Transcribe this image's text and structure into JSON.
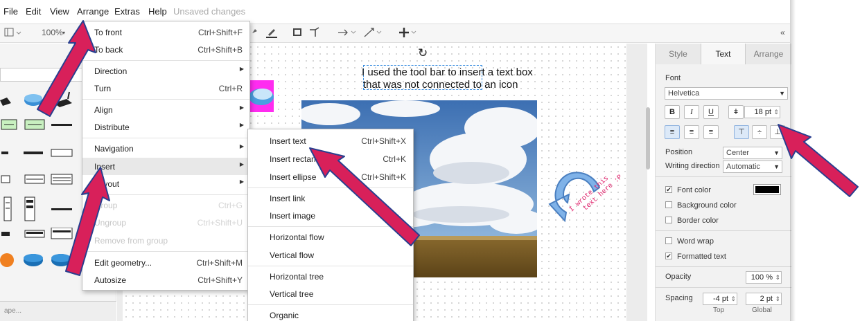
{
  "menubar": {
    "items": [
      "File",
      "Edit",
      "View",
      "Arrange",
      "Extras",
      "Help"
    ],
    "status": "Unsaved changes"
  },
  "toolbar": {
    "zoom": "100%"
  },
  "left_panel": {
    "footer_text": "ape..."
  },
  "canvas": {
    "textbox_line1": "I used the tool bar to insert a text box",
    "textbox_line2": "that was not connected to an icon",
    "handwritten_line1": "I wrote this",
    "handwritten_line2": "text here :P"
  },
  "arrange_menu": {
    "items": [
      {
        "label": "To front",
        "shortcut": "Ctrl+Shift+F"
      },
      {
        "label": "To back",
        "shortcut": "Ctrl+Shift+B"
      },
      {
        "label": "Direction",
        "shortcut": ""
      },
      {
        "label": "Turn",
        "shortcut": "Ctrl+R"
      },
      {
        "label": "Align",
        "shortcut": ""
      },
      {
        "label": "Distribute",
        "shortcut": ""
      },
      {
        "label": "Navigation",
        "shortcut": ""
      },
      {
        "label": "Insert",
        "shortcut": ""
      },
      {
        "label": "Layout",
        "shortcut": ""
      },
      {
        "label": "Group",
        "shortcut": "Ctrl+G"
      },
      {
        "label": "Ungroup",
        "shortcut": "Ctrl+Shift+U"
      },
      {
        "label": "Remove from group",
        "shortcut": ""
      },
      {
        "label": "Edit geometry...",
        "shortcut": "Ctrl+Shift+M"
      },
      {
        "label": "Autosize",
        "shortcut": "Ctrl+Shift+Y"
      }
    ]
  },
  "insert_submenu": {
    "items": [
      {
        "label": "Insert text",
        "shortcut": "Ctrl+Shift+X"
      },
      {
        "label": "Insert rectangle",
        "shortcut": "Ctrl+K"
      },
      {
        "label": "Insert ellipse",
        "shortcut": "Ctrl+Shift+K"
      },
      {
        "label": "Insert link",
        "shortcut": ""
      },
      {
        "label": "Insert image",
        "shortcut": ""
      },
      {
        "label": "Horizontal flow",
        "shortcut": ""
      },
      {
        "label": "Vertical flow",
        "shortcut": ""
      },
      {
        "label": "Horizontal tree",
        "shortcut": ""
      },
      {
        "label": "Vertical tree",
        "shortcut": ""
      },
      {
        "label": "Organic",
        "shortcut": ""
      }
    ]
  },
  "format_panel": {
    "tabs": [
      "Style",
      "Text",
      "Arrange"
    ],
    "font_heading": "Font",
    "font_family": "Helvetica",
    "bold": "B",
    "italic": "I",
    "underline": "U",
    "font_size": "18 pt",
    "position_label": "Position",
    "position_value": "Center",
    "writing_direction_label": "Writing direction",
    "writing_direction_value": "Automatic",
    "font_color_label": "Font color",
    "background_color_label": "Background color",
    "border_color_label": "Border color",
    "word_wrap_label": "Word wrap",
    "formatted_text_label": "Formatted text",
    "opacity_label": "Opacity",
    "opacity_value": "100 %",
    "spacing_label": "Spacing",
    "spacing_top_value": "-4 pt",
    "spacing_global_value": "2 pt",
    "spacing_top_caption": "Top",
    "spacing_global_caption": "Global",
    "font_color_swatch": "#000000"
  },
  "colors": {
    "arrow_fill": "#d8205a",
    "arrow_outline": "#2a3f8f",
    "accent_blue": "#3c8fe0"
  }
}
